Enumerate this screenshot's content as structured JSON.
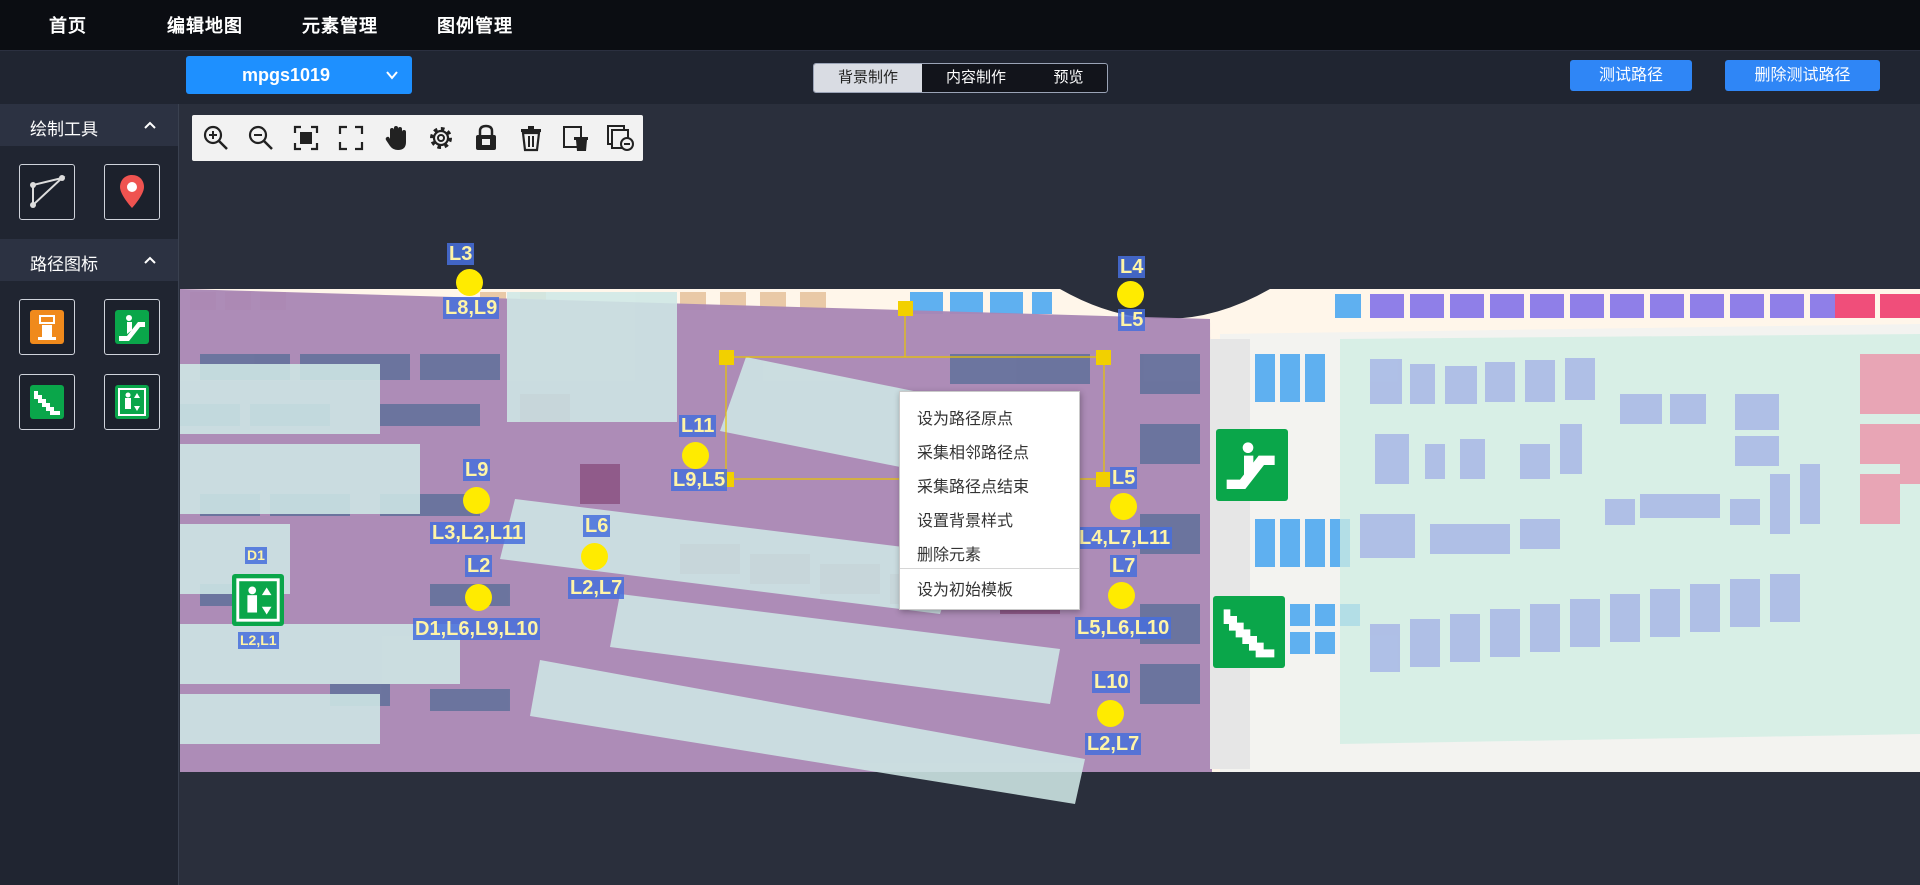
{
  "nav": [
    "首页",
    "编辑地图",
    "元素管理",
    "图例管理"
  ],
  "map_selector": {
    "value": "mpgs1019"
  },
  "modes": [
    "背景制作",
    "内容制作",
    "预览"
  ],
  "active_mode": "背景制作",
  "actions": {
    "test_route": "测试路径",
    "delete_test_route": "删除测试路径"
  },
  "sidebar": {
    "draw_tools_title": "绘制工具",
    "draw_tools": [
      "polygon-tool-icon",
      "location-pin-icon"
    ],
    "route_icons_title": "路径图标",
    "route_icons": [
      "ticket-machine-icon",
      "escalator-icon",
      "stairs-icon",
      "elevator-icon"
    ]
  },
  "toolbar_icons": [
    "zoom-in-icon",
    "zoom-out-icon",
    "fit-screen-icon",
    "fullscreen-icon",
    "pan-hand-icon",
    "settings-icon",
    "lock-icon",
    "delete-icon",
    "clear-icon",
    "remove-layer-icon"
  ],
  "context_menu": [
    "设为路径原点",
    "采集相邻路径点",
    "采集路径点结束",
    "设置背景样式",
    "删除元素",
    "设为初始模板"
  ],
  "path_points": [
    {
      "name": "L3",
      "neighbors": "L8,L9"
    },
    {
      "name": "L4",
      "neighbors": "L5"
    },
    {
      "name": "L11",
      "neighbors": "L9,L5"
    },
    {
      "name": "L9",
      "neighbors": "L3,L2,L11"
    },
    {
      "name": "L6",
      "neighbors": "L2,L7"
    },
    {
      "name": "L2",
      "neighbors": "D1,L6,L9,L10"
    },
    {
      "name": "L5",
      "neighbors": "L4,L7,L11"
    },
    {
      "name": "L7",
      "neighbors": "L5,L6,L10"
    },
    {
      "name": "L10",
      "neighbors": "L2,L7"
    },
    {
      "name": "D1",
      "neighbors": "L2,L1"
    }
  ],
  "colors": {
    "accent": "#1e90ff",
    "button": "#2f86f6",
    "path_point": "#ffeb00",
    "sign_green": "#0aa64a",
    "ticket_orange": "#f08a1c",
    "pin_red": "#ef5350"
  }
}
